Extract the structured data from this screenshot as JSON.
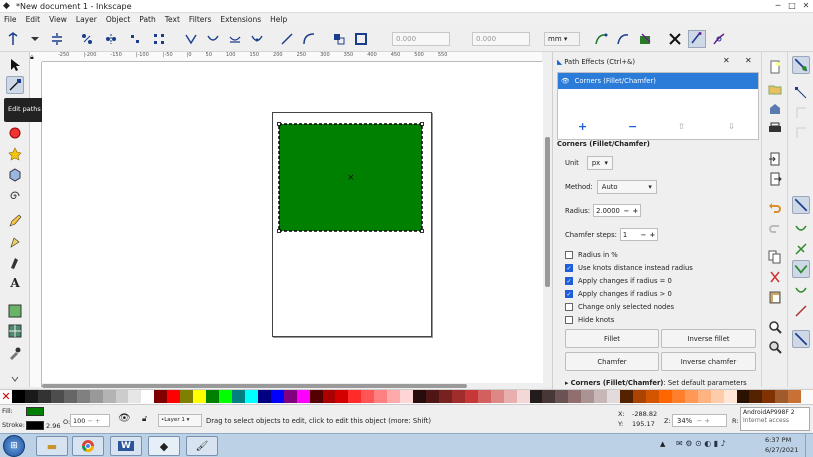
{
  "window": {
    "title": "*New document 1 - Inkscape",
    "min": "─",
    "max": "□",
    "close": "✕"
  },
  "menu": [
    "File",
    "Edit",
    "View",
    "Layer",
    "Object",
    "Path",
    "Text",
    "Filters",
    "Extensions",
    "Help"
  ],
  "toolbar": {
    "x_label": "X:",
    "x_value": "0.000",
    "y_label": "Y:",
    "y_value": "0.000",
    "unit": "mm",
    "minus": "−",
    "plus": "+"
  },
  "ruler": {
    "marks": [
      "-250",
      "|-200",
      "-150",
      "|-100",
      "|-50",
      "|0",
      "50",
      "100",
      "150",
      "200",
      "250",
      "300",
      "350",
      "400",
      "450",
      "500",
      "550"
    ]
  },
  "tooltip": {
    "text": "Edit paths by nodes (N)"
  },
  "canvas": {
    "rect_fill": "#008000",
    "center_marker": "×"
  },
  "panel": {
    "header": "Path Effects (Ctrl+&)",
    "effect_name": "Corners (Fillet/Chamfer)",
    "section_title": "Corners (Fillet/Chamfer)",
    "unit_label": "Unit",
    "unit_value": "px",
    "method_label": "Method:",
    "method_value": "Auto",
    "radius_label": "Radius:",
    "radius_value": "2.0000",
    "chamfer_label": "Chamfer steps:",
    "chamfer_value": "1",
    "checkboxes": [
      {
        "label": "Radius in %",
        "checked": false
      },
      {
        "label": "Use knots distance instead radius",
        "checked": true
      },
      {
        "label": "Apply changes if radius = 0",
        "checked": true
      },
      {
        "label": "Apply changes if radius > 0",
        "checked": true
      },
      {
        "label": "Change only selected nodes",
        "checked": false
      },
      {
        "label": "Hide knots",
        "checked": false
      }
    ],
    "buttons": {
      "fillet": "Fillet",
      "inverse_fillet": "Inverse fillet",
      "chamfer": "Chamfer",
      "inverse_chamfer": "Inverse chamfer"
    },
    "footer_name": "Corners (Fillet/Chamfer)",
    "footer_text": ": Set default parameters",
    "add": "+",
    "remove": "−"
  },
  "status": {
    "fill_label": "Fill:",
    "stroke_label": "Stroke:",
    "stroke_width": "2.96",
    "opacity_label": "O:",
    "opacity_value": "100",
    "layer": "•Layer 1",
    "message": "Drag to select objects to edit, click to edit this object (more: Shift)",
    "x_label": "X:",
    "x_value": "-288.82",
    "y_label": "Y:",
    "y_value": "195.17",
    "z_label": "Z:",
    "zoom": "34%",
    "r_label": "R:",
    "network_name": "AndroidAP998F",
    "network_status": "Internet access",
    "network_count": "2"
  },
  "taskbar": {
    "time": "6:37 PM",
    "date": "6/27/2021"
  },
  "palette": [
    "#000000",
    "#1a1a1a",
    "#333333",
    "#4d4d4d",
    "#666666",
    "#808080",
    "#999999",
    "#b3b3b3",
    "#cccccc",
    "#e6e6e6",
    "#ffffff",
    "#800000",
    "#ff0000",
    "#808000",
    "#ffff00",
    "#008000",
    "#00ff00",
    "#008080",
    "#00ffff",
    "#000080",
    "#0000ff",
    "#800080",
    "#ff00ff",
    "#550000",
    "#aa0000",
    "#d40000",
    "#ff2a2a",
    "#ff5555",
    "#ff8080",
    "#ffaaaa",
    "#ffd5d5",
    "#280b0b",
    "#501616",
    "#782121",
    "#a02c2c",
    "#c83737",
    "#d35f5f",
    "#de8787",
    "#e9afaf",
    "#f4d7d7",
    "#241c1c",
    "#483737",
    "#6c5353",
    "#916f6f",
    "#ac9393",
    "#c8b7b7",
    "#e3dbdb",
    "#552200",
    "#aa4400",
    "#d45500",
    "#ff6600",
    "#ff7f2a",
    "#ff9955",
    "#ffb380",
    "#ffccaa",
    "#ffe6d5",
    "#2b1100",
    "#552200",
    "#803300",
    "#a05a2c",
    "#c87137"
  ]
}
